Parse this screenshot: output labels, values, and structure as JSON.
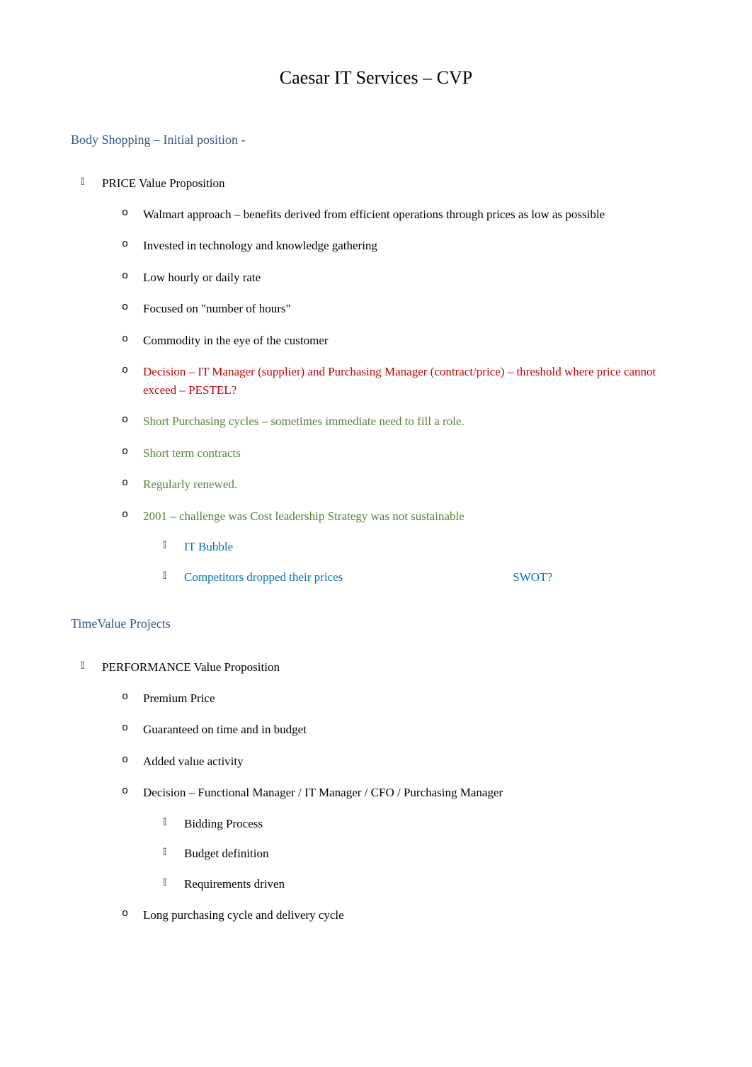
{
  "title": "Caesar IT Services – CVP",
  "section1": {
    "heading": "Body Shopping – Initial position -",
    "main_item": "PRICE Value Proposition",
    "items": [
      {
        "text": "Walmart approach – benefits derived from efficient operations through prices as low as possible",
        "color": "black"
      },
      {
        "text": "Invested in technology and knowledge gathering",
        "color": "black"
      },
      {
        "text": "Low hourly or daily rate",
        "color": "black"
      },
      {
        "text": "Focused on \"number of hours\"",
        "color": "black"
      },
      {
        "text": "Commodity in the eye of the customer",
        "color": "black"
      },
      {
        "text": "Decision – IT Manager (supplier) and Purchasing Manager (contract/price) – threshold where price cannot exceed –   PESTEL?",
        "color": "red"
      },
      {
        "text": "Short Purchasing cycles – sometimes immediate need to fill a role.",
        "color": "green"
      },
      {
        "text": "Short term contracts",
        "color": "green"
      },
      {
        "text": "Regularly renewed.",
        "color": "green"
      },
      {
        "text": "2001 – challenge was Cost leadership Strategy was not sustainable",
        "color": "green"
      }
    ],
    "sub_items": {
      "bubble": "IT Bubble",
      "competitors": "Competitors dropped their prices",
      "swot": "SWOT?"
    }
  },
  "section2": {
    "heading": "TimeValue Projects",
    "main_item": "PERFORMANCE Value Proposition",
    "items": [
      {
        "text": "Premium Price"
      },
      {
        "text": "Guaranteed on time and in budget"
      },
      {
        "text": "Added value activity"
      },
      {
        "text": "Decision – Functional Manager / IT Manager / CFO / Purchasing Manager"
      }
    ],
    "sub_items": [
      "Bidding Process",
      "Budget definition",
      "Requirements driven"
    ],
    "last_item": "Long purchasing cycle and delivery cycle"
  }
}
